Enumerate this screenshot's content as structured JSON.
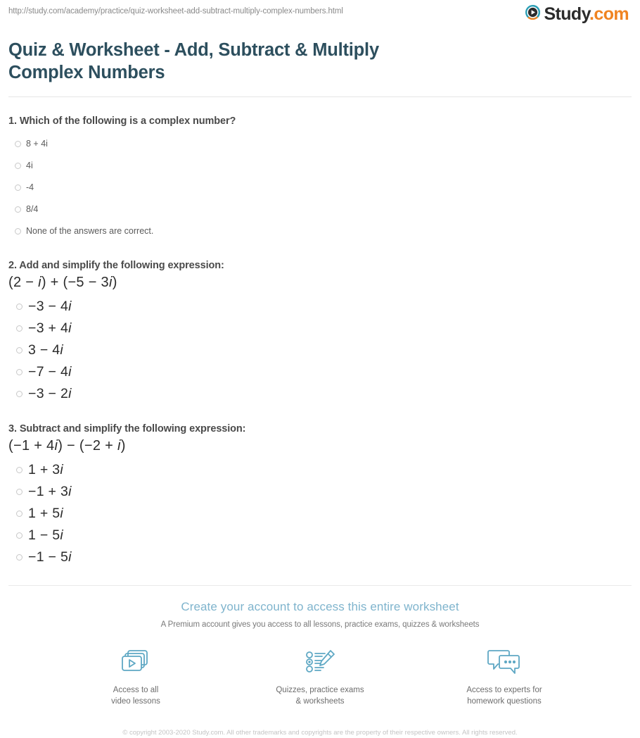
{
  "header": {
    "url": "http://study.com/academy/practice/quiz-worksheet-add-subtract-multiply-complex-numbers.html",
    "logo_name": "Study",
    "logo_suffix": ".com",
    "logo_icon": "play-circle-icon",
    "logo_teal": "#2c9fb5",
    "logo_orange": "#f08421"
  },
  "title": "Quiz & Worksheet - Add, Subtract & Multiply Complex Numbers",
  "title_color": "#2d4f5e",
  "questions": [
    {
      "prompt": "1. Which of the following is a complex number?",
      "expression": "",
      "style": "plain",
      "options": [
        "8 + 4i",
        "4i",
        "-4",
        "8/4",
        "None of the answers are correct."
      ]
    },
    {
      "prompt": "2. Add and simplify the following expression:",
      "expression": "(2 − i) + (−5 − 3i)",
      "style": "math",
      "options": [
        "−3 − 4i",
        "−3 + 4i",
        "3 − 4i",
        "−7 − 4i",
        "−3 − 2i"
      ]
    },
    {
      "prompt": "3. Subtract and simplify the following expression:",
      "expression": "(−1 + 4i) − (−2 + i)",
      "style": "math",
      "options": [
        "1 + 3i",
        "−1 + 3i",
        "1 + 5i",
        "1 − 5i",
        "−1 − 5i"
      ]
    }
  ],
  "cta": {
    "headline": "Create your account to access this entire worksheet",
    "subline": "A Premium account gives you access to all lessons, practice exams, quizzes & worksheets",
    "headline_color": "#7fb4cd",
    "features": [
      {
        "icon": "video-lessons-icon",
        "line1": "Access to all",
        "line2": "video lessons"
      },
      {
        "icon": "quiz-pencil-icon",
        "line1": "Quizzes, practice exams",
        "line2": "& worksheets"
      },
      {
        "icon": "chat-bubbles-icon",
        "line1": "Access to experts for",
        "line2": "homework questions"
      }
    ],
    "icon_color": "#5fa8c4"
  },
  "copyright": "© copyright 2003-2020 Study.com. All other trademarks and copyrights are the property of their respective owners. All rights reserved."
}
